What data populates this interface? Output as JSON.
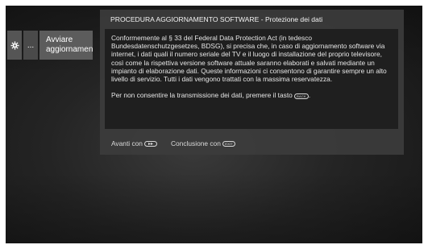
{
  "menu": {
    "gear_icon": "gear-icon",
    "more_label": "...",
    "update_label_line1": "Avviare",
    "update_label_line2": "aggiornamen"
  },
  "dialog": {
    "title": "PROCEDURA AGGIORNAMENTO SOFTWARE - Protezione dei dati",
    "paragraph1": "Conformemente al § 33 del Federal Data Protection Act (in tedesco Bundesdatenschutzgesetzes, BDSG), si precisa che, in caso di aggiornamento software via internet, i dati quali il numero seriale del TV e il luogo di installazione del proprio televisore, così come la rispettiva versione software attuale saranno elaborati e salvati mediante un impianto di elaborazione dati. Queste informazioni ci consentono di garantire sempre un alto livello di servizio. Tutti i dati vengono trattati con la massima reservatezza.",
    "paragraph2_before": "Per non consentire la transmissione dei dati, premere il tasto",
    "paragraph2_after": ".",
    "back_key_label": "BACK",
    "footer_forward": "Avanti con",
    "footer_conclude": "Conclusione con",
    "exit_key_label": "EXIT"
  },
  "colors": {
    "dialog_bg": "#3c3c3c",
    "body_bg": "#1f1f1f",
    "tile_bg": "#555555"
  }
}
